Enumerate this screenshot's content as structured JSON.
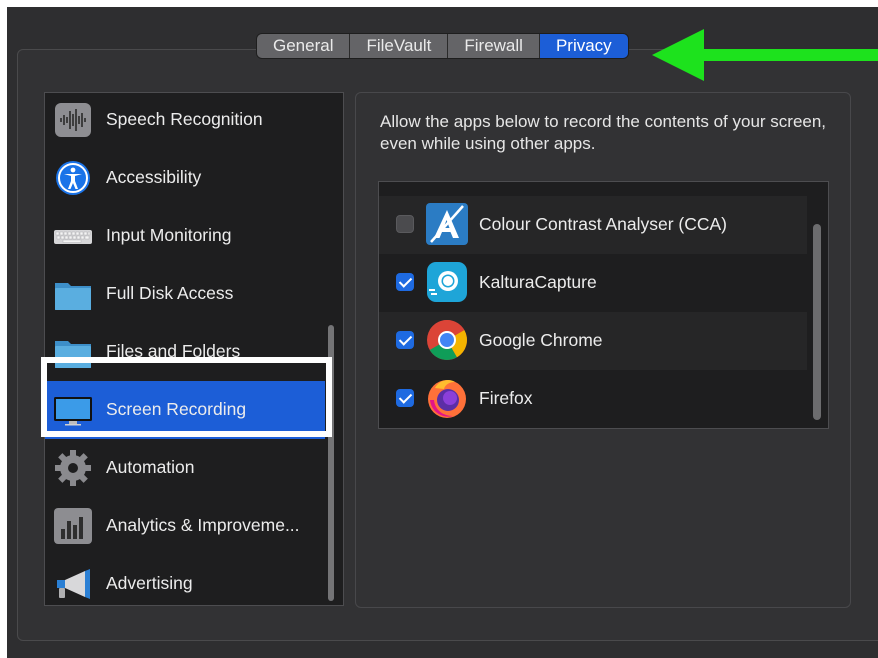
{
  "tabs": [
    {
      "label": "General"
    },
    {
      "label": "FileVault"
    },
    {
      "label": "Firewall"
    },
    {
      "label": "Privacy",
      "active": true
    }
  ],
  "sidebar": {
    "items": [
      {
        "label": "Speech Recognition",
        "icon": "waveform-icon"
      },
      {
        "label": "Accessibility",
        "icon": "accessibility-icon"
      },
      {
        "label": "Input Monitoring",
        "icon": "keyboard-icon"
      },
      {
        "label": "Full Disk Access",
        "icon": "folder-icon"
      },
      {
        "label": "Files and Folders",
        "icon": "folder-icon"
      },
      {
        "label": "Screen Recording",
        "icon": "display-icon",
        "selected": true
      },
      {
        "label": "Automation",
        "icon": "gear-icon"
      },
      {
        "label": "Analytics & Improveme...",
        "icon": "bar-chart-icon"
      },
      {
        "label": "Advertising",
        "icon": "megaphone-icon"
      }
    ]
  },
  "main": {
    "description": "Allow the apps below to record the contents of your screen, even while using other apps.",
    "apps": [
      {
        "label": "Colour Contrast Analyser (CCA)",
        "checked": false,
        "icon": "cca-app-icon"
      },
      {
        "label": "KalturaCapture",
        "checked": true,
        "icon": "kaltura-app-icon"
      },
      {
        "label": "Google Chrome",
        "checked": true,
        "icon": "chrome-app-icon"
      },
      {
        "label": "Firefox",
        "checked": true,
        "icon": "firefox-app-icon"
      }
    ]
  },
  "colors": {
    "accent": "#1c5ed7",
    "annotation_arrow": "#1de21d",
    "highlight_box": "#ffffff"
  }
}
